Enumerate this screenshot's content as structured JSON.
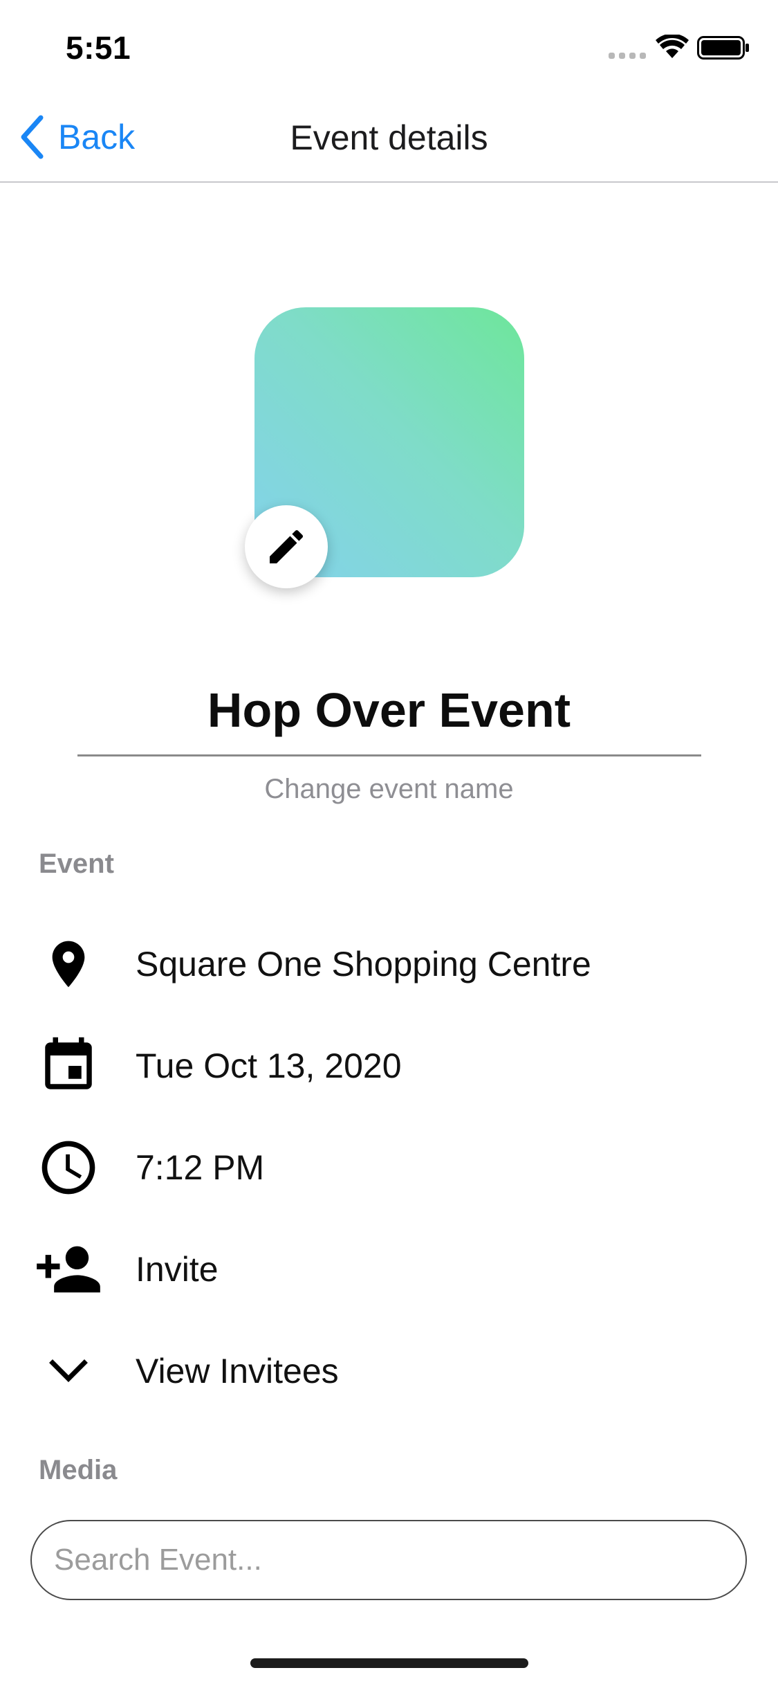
{
  "status_bar": {
    "time": "5:51"
  },
  "nav": {
    "back_label": "Back",
    "title": "Event details"
  },
  "event": {
    "name": "Hop Over Event",
    "name_hint": "Change event name",
    "image_gradient": [
      "#6ee69a",
      "#84d2ec"
    ]
  },
  "sections": {
    "event_label": "Event",
    "media_label": "Media"
  },
  "details": {
    "location": "Square One Shopping Centre",
    "date": "Tue Oct 13, 2020",
    "time": "7:12 PM",
    "invite": "Invite",
    "view_invitees": "View Invitees"
  },
  "icons": {
    "location": "map-pin-icon",
    "date": "calendar-icon",
    "time": "clock-icon",
    "invite": "add-person-icon",
    "view_invitees": "chevron-down-icon",
    "edit": "pencil-icon"
  },
  "search": {
    "placeholder": "Search Event..."
  },
  "colors": {
    "accent": "#1a86f5",
    "secondary_text": "#8e8e93"
  }
}
